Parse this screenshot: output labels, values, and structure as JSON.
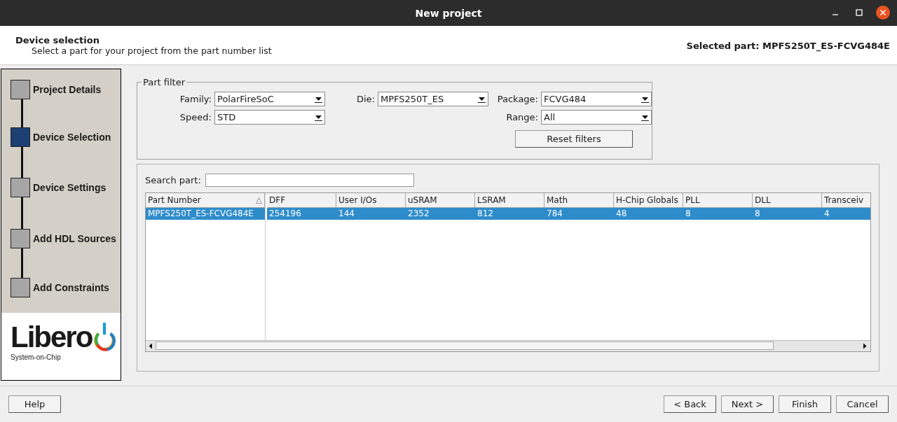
{
  "window": {
    "title": "New project"
  },
  "header": {
    "title": "Device selection",
    "subtitle": "Select a part for your project from the part number list",
    "selected_part": "Selected part: MPFS250T_ES-FCVG484E"
  },
  "steps": [
    {
      "label": "Project Details",
      "selected": false
    },
    {
      "label": "Device Selection",
      "selected": true
    },
    {
      "label": "Device Settings",
      "selected": false
    },
    {
      "label": "Add HDL Sources",
      "selected": false
    },
    {
      "label": "Add Constraints",
      "selected": false
    }
  ],
  "logo": {
    "name": "Libero",
    "tagline": "System-on-Chip"
  },
  "part_filter": {
    "title": "Part filter",
    "family": {
      "label": "Family:",
      "value": "PolarFireSoC"
    },
    "speed": {
      "label": "Speed:",
      "value": "STD"
    },
    "die": {
      "label": "Die:",
      "value": "MPFS250T_ES"
    },
    "package": {
      "label": "Package:",
      "value": "FCVG484"
    },
    "range": {
      "label": "Range:",
      "value": "All"
    },
    "reset_button": "Reset filters"
  },
  "search": {
    "label": "Search part:"
  },
  "table": {
    "key_column": "Part Number",
    "columns": [
      "DFF",
      "User I/Os",
      "uSRAM",
      "LSRAM",
      "Math",
      "H-Chip Globals",
      "PLL",
      "DLL",
      "Transceiv"
    ],
    "rows": [
      {
        "part": "MPFS250T_ES-FCVG484E",
        "cells": [
          "254196",
          "144",
          "2352",
          "812",
          "784",
          "48",
          "8",
          "8",
          "4"
        ],
        "selected": true
      }
    ]
  },
  "buttons": {
    "help": "Help",
    "back": "< Back",
    "next": "Next >",
    "finish": "Finish",
    "cancel": "Cancel"
  }
}
